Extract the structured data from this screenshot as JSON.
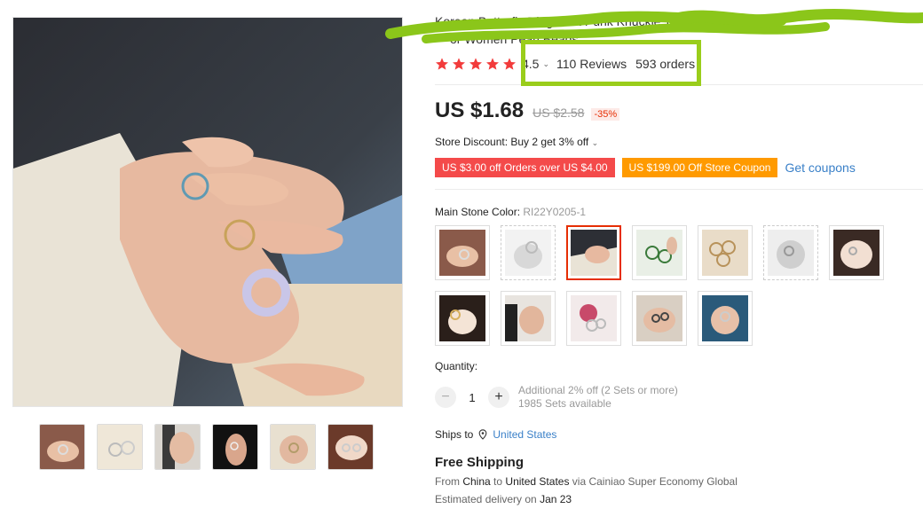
{
  "product": {
    "title_visible_line1": "Korean Butterfly Rings Set Punk Knuckle Thin Rings for",
    "title_visible_line2": "or Women Pearl Beads",
    "rating": "4.5",
    "reviews": "110 Reviews",
    "orders": "593 orders"
  },
  "price": {
    "current": "US $1.68",
    "original": "US $2.58",
    "discount": "-35%"
  },
  "store_discount": {
    "label": "Store Discount: Buy 2 get 3% off",
    "chevron": "chevron-down-icon"
  },
  "coupons": {
    "coupon1": "US $3.00 off Orders over US $4.00",
    "coupon2": "US $199.00 Off Store Coupon",
    "get_coupons": "Get coupons"
  },
  "variant": {
    "label": "Main Stone Color:",
    "selected_sku": "RI22Y0205-1",
    "selected_index": 2
  },
  "quantity": {
    "label": "Quantity:",
    "minus": "−",
    "value": "1",
    "plus": "+",
    "note_line1": "Additional 2% off (2 Sets or more)",
    "note_line2": "1985 Sets available"
  },
  "shipping": {
    "ships_to_label": "Ships to",
    "country": "United States",
    "free_shipping": "Free Shipping",
    "from_prefix": "From",
    "from_country": "China",
    "to_word": "to",
    "to_country": "United States",
    "via_text": "via Cainiao Super Economy Global",
    "delivery_prefix": "Estimated delivery on",
    "delivery_date": "Jan 23"
  },
  "colors": {
    "star": "#f23b3b",
    "price_red": "#e62e04",
    "coupon_red": "#f44a4a",
    "coupon_orange": "#ff9a00",
    "link_blue": "#3a80c8",
    "highlight_green": "#9acd1b"
  }
}
